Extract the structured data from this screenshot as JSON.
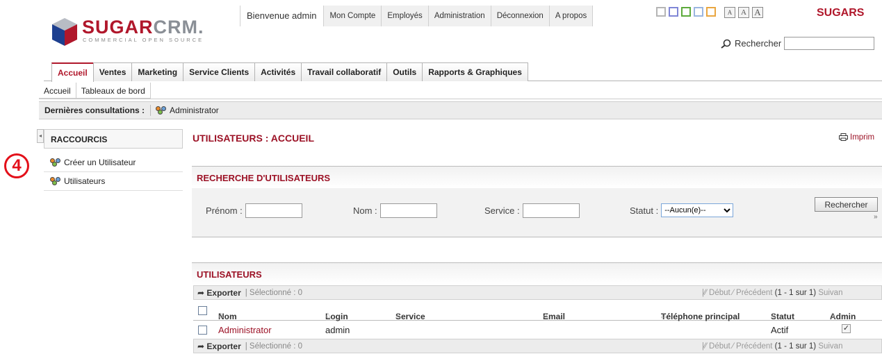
{
  "header": {
    "logo_sugar": "SUGAR",
    "logo_crm": "CRM.",
    "tagline": "COMMERCIAL OPEN SOURCE",
    "welcome": "Bienvenue admin",
    "links": [
      "Mon Compte",
      "Employés",
      "Administration",
      "Déconnexion",
      "A propos"
    ],
    "brand_right": "SUGARS",
    "search_label": "Rechercher",
    "theme_colors": [
      "#b5b5b5",
      "#7f86d6",
      "#5caa3b",
      "#9bb6e0",
      "#e9a640"
    ],
    "font_sizes": [
      "A",
      "A",
      "A"
    ]
  },
  "tabs": [
    "Accueil",
    "Ventes",
    "Marketing",
    "Service Clients",
    "Activités",
    "Travail collaboratif",
    "Outils",
    "Rapports & Graphiques"
  ],
  "subtabs": [
    "Accueil",
    "Tableaux de bord"
  ],
  "last_viewed": {
    "label": "Dernières consultations :",
    "item": "Administrator"
  },
  "sidebar": {
    "title": "RACCOURCIS",
    "items": [
      "Créer un Utilisateur",
      "Utilisateurs"
    ]
  },
  "step_badge": "4",
  "main": {
    "title": "UTILISATEURS : ACCUEIL",
    "print": "Imprim"
  },
  "search": {
    "title": "RECHERCHE D'UTILISATEURS",
    "firstname_label": "Prénom :",
    "lastname_label": "Nom :",
    "department_label": "Service :",
    "status_label": "Statut :",
    "status_value": "--Aucun(e)--",
    "button": "Rechercher"
  },
  "list": {
    "title": "UTILISATEURS",
    "export": "Exporter",
    "selected": "| Sélectionné :  0",
    "nav_start": "Début",
    "nav_prev": "Précédent",
    "nav_count": "(1 - 1 sur 1)",
    "nav_next": "Suivan",
    "columns": [
      "Nom",
      "Login",
      "Service",
      "Email",
      "Téléphone principal",
      "Statut",
      "Admin"
    ],
    "rows": [
      {
        "name": "Administrator",
        "login": "admin",
        "service": "",
        "email": "",
        "phone": "",
        "status": "Actif",
        "admin": "✓"
      }
    ]
  }
}
